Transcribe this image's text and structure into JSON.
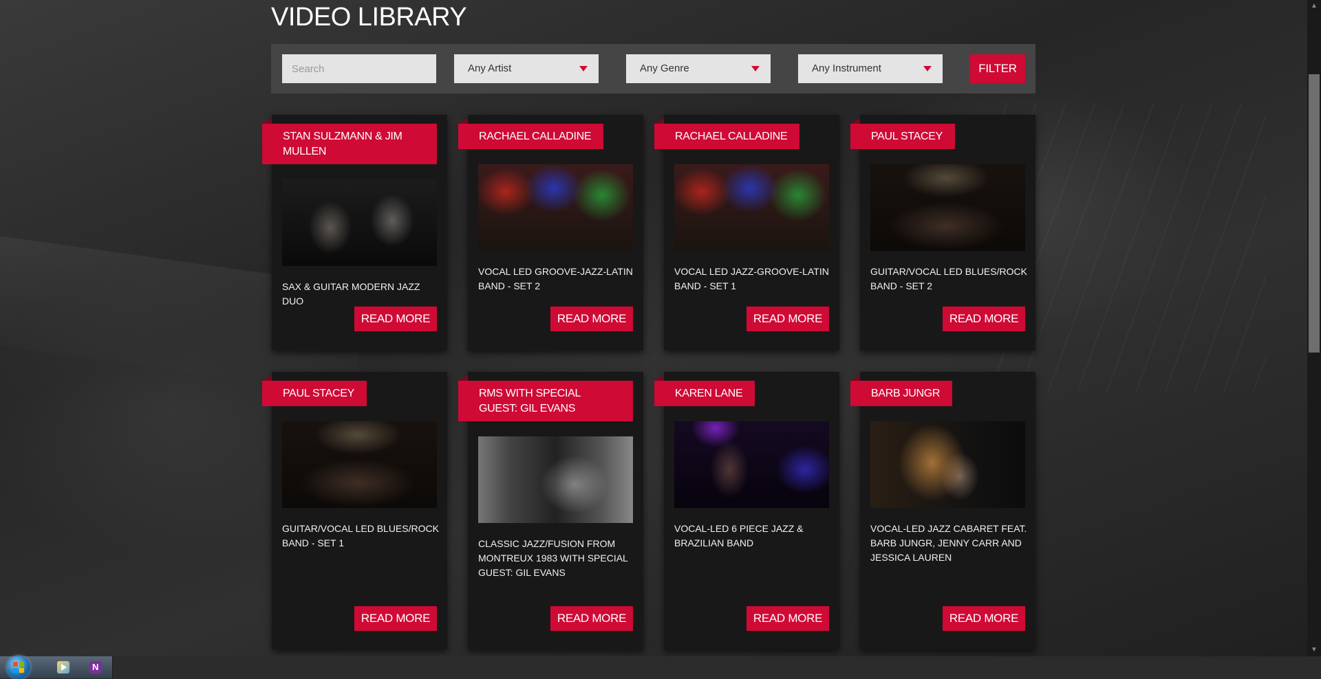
{
  "page": {
    "title": "VIDEO LIBRARY"
  },
  "filters": {
    "search_placeholder": "Search",
    "artist": "Any Artist",
    "genre": "Any Genre",
    "instrument": "Any Instrument",
    "filter_label": "FILTER"
  },
  "videos": [
    {
      "artist": "STAN SULZMANN & JIM MULLEN",
      "description": "SAX & GUITAR MODERN JAZZ DUO",
      "button": "READ MORE"
    },
    {
      "artist": "RACHAEL CALLADINE",
      "description": "VOCAL LED GROOVE-JAZZ-LATIN BAND - SET 2",
      "button": "READ MORE"
    },
    {
      "artist": "RACHAEL CALLADINE",
      "description": "VOCAL LED JAZZ-GROOVE-LATIN BAND - SET 1",
      "button": "READ MORE"
    },
    {
      "artist": "PAUL STACEY",
      "description": "GUITAR/VOCAL LED BLUES/ROCK BAND - SET 2",
      "button": "READ MORE"
    },
    {
      "artist": "PAUL STACEY",
      "description": "GUITAR/VOCAL LED BLUES/ROCK BAND - SET 1",
      "button": "READ MORE"
    },
    {
      "artist": "RMS WITH SPECIAL GUEST: GIL EVANS",
      "description": "CLASSIC JAZZ/FUSION FROM MONTREUX 1983 WITH SPECIAL GUEST: GIL EVANS",
      "button": "READ MORE"
    },
    {
      "artist": "KAREN LANE",
      "description": "VOCAL-LED 6 PIECE JAZZ & BRAZILIAN BAND",
      "button": "READ MORE"
    },
    {
      "artist": "BARB JUNGR",
      "description": "VOCAL-LED JAZZ CABARET FEAT. BARB JUNGR, JENNY CARR AND JESSICA LAUREN",
      "button": "READ MORE"
    }
  ],
  "colors": {
    "accent": "#cf0a35",
    "card_bg": "#181818",
    "filter_bg": "#454545"
  },
  "taskbar": {
    "icons": [
      "windows-start-icon",
      "media-player-icon",
      "onenote-icon"
    ]
  }
}
